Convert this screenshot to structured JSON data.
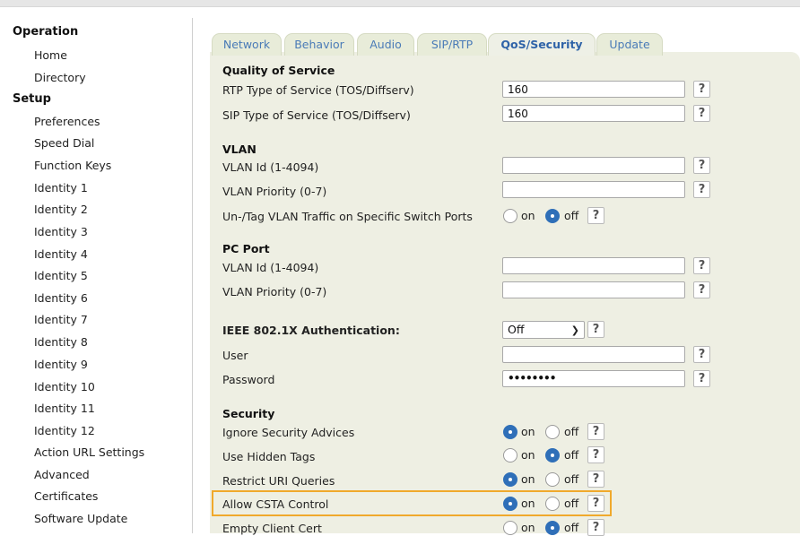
{
  "sidebar": {
    "sections": [
      {
        "label": "Operation",
        "items": [
          "Home",
          "Directory"
        ]
      },
      {
        "label": "Setup",
        "items": [
          "Preferences",
          "Speed Dial",
          "Function Keys",
          "Identity 1",
          "Identity 2",
          "Identity 3",
          "Identity 4",
          "Identity 5",
          "Identity 6",
          "Identity 7",
          "Identity 8",
          "Identity 9",
          "Identity 10",
          "Identity 11",
          "Identity 12",
          "Action URL Settings",
          "Advanced",
          "Certificates",
          "Software Update"
        ]
      }
    ]
  },
  "tabs": [
    {
      "label": "Network",
      "active": false
    },
    {
      "label": "Behavior",
      "active": false
    },
    {
      "label": "Audio",
      "active": false
    },
    {
      "label": "SIP/RTP",
      "active": false
    },
    {
      "label": "QoS/Security",
      "active": true
    },
    {
      "label": "Update",
      "active": false
    }
  ],
  "qos": {
    "title": "Quality of Service",
    "rtp_tos_label": "RTP Type of Service (TOS/Diffserv)",
    "rtp_tos_value": "160",
    "sip_tos_label": "SIP Type of Service (TOS/Diffserv)",
    "sip_tos_value": "160"
  },
  "vlan": {
    "title": "VLAN",
    "id_label": "VLAN Id (1-4094)",
    "id_value": "",
    "priority_label": "VLAN Priority (0-7)",
    "priority_value": "",
    "untag_label": "Un-/Tag VLAN Traffic on Specific Switch Ports",
    "untag_value": "off"
  },
  "pc_port": {
    "title": "PC Port",
    "id_label": "VLAN Id (1-4094)",
    "id_value": "",
    "priority_label": "VLAN Priority (0-7)",
    "priority_value": ""
  },
  "auth": {
    "title": "IEEE 802.1X Authentication:",
    "mode_value": "Off",
    "user_label": "User",
    "user_value": "",
    "password_label": "Password",
    "password_value": "••••••••"
  },
  "security": {
    "title": "Security",
    "rows": [
      {
        "label": "Ignore Security Advices",
        "value": "on"
      },
      {
        "label": "Use Hidden Tags",
        "value": "off"
      },
      {
        "label": "Restrict URI Queries",
        "value": "on"
      },
      {
        "label": "Allow CSTA Control",
        "value": "on"
      },
      {
        "label": "Empty Client Cert",
        "value": "off"
      }
    ]
  },
  "radio": {
    "on_label": "on",
    "off_label": "off"
  },
  "help_label": "?",
  "colors": {
    "accent": "#2f6fb8",
    "highlight": "#f0a92c",
    "panel": "#eeefe3",
    "tab_text": "#4a7bb7"
  }
}
